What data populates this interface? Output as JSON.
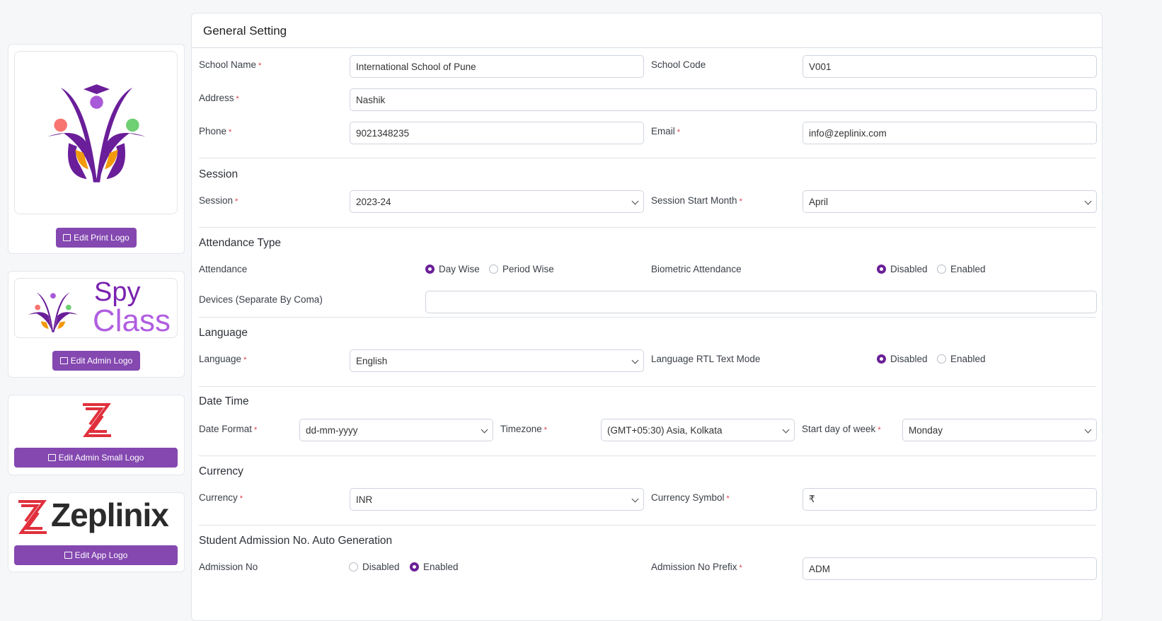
{
  "logos": {
    "print_button": "Edit Print Logo",
    "admin_button": "Edit Admin Logo",
    "admin_logo_text": [
      "Spy",
      "Class"
    ],
    "small_button": "Edit Admin Small Logo",
    "app_button": "Edit App Logo",
    "app_logo_text": "Zeplinix"
  },
  "title": "General Setting",
  "fields": {
    "school_name": {
      "label": "School Name",
      "value": "International School of Pune"
    },
    "school_code": {
      "label": "School Code",
      "value": "V001"
    },
    "address": {
      "label": "Address",
      "value": "Nashik"
    },
    "phone": {
      "label": "Phone",
      "value": "9021348235"
    },
    "email": {
      "label": "Email",
      "value": "info@zeplinix.com"
    }
  },
  "session": {
    "heading": "Session",
    "session_label": "Session",
    "session_value": "2023-24",
    "start_label": "Session Start Month",
    "start_value": "April"
  },
  "attendance": {
    "heading": "Attendance Type",
    "label": "Attendance",
    "opt1": "Day Wise",
    "opt2": "Period Wise",
    "bio_label": "Biometric Attendance",
    "bio_opt1": "Disabled",
    "bio_opt2": "Enabled",
    "devices_label": "Devices (Separate By Coma)",
    "devices_value": ""
  },
  "language": {
    "heading": "Language",
    "label": "Language",
    "value": "English",
    "rtl_label": "Language RTL Text Mode",
    "opt1": "Disabled",
    "opt2": "Enabled"
  },
  "datetime": {
    "heading": "Date Time",
    "format_label": "Date Format",
    "format_value": "dd-mm-yyyy",
    "tz_label": "Timezone",
    "tz_value": "(GMT+05:30) Asia, Kolkata",
    "week_label": "Start day of week",
    "week_value": "Monday"
  },
  "currency": {
    "heading": "Currency",
    "label": "Currency",
    "value": "INR",
    "symbol_label": "Currency Symbol",
    "symbol_value": "₹"
  },
  "admission": {
    "heading": "Student Admission No. Auto Generation",
    "label": "Admission No",
    "opt1": "Disabled",
    "opt2": "Enabled",
    "prefix_label": "Admission No Prefix",
    "prefix_value": "ADM"
  },
  "required_mark": "*"
}
